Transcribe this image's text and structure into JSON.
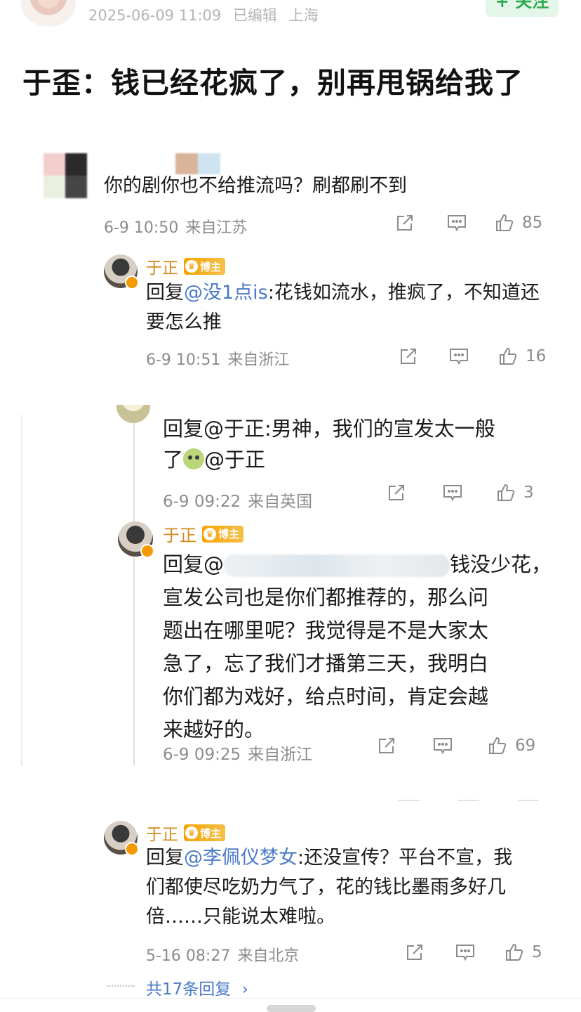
{
  "header": {
    "timestamp": "2025-06-09 11:09",
    "edited": "已编辑",
    "location": "上海",
    "follow_label": "+ 关注"
  },
  "headline": "于歪：钱已经花疯了，别再甩锅给我了",
  "comment1": {
    "text": "你的剧你也不给推流吗？刷都刷不到",
    "time": "6-9 10:50",
    "from": "来自江苏",
    "likes": "85"
  },
  "reply1": {
    "user": "于正",
    "badge": "博主",
    "prefix": "回复",
    "mention": "@没1点is",
    "text": ":花钱如流水，推疯了，不知道还要怎么推",
    "time": "6-9 10:51",
    "from": "来自浙江",
    "likes": "16"
  },
  "comment2": {
    "text_line1": "回复@于正:男神，我们的宣发太一般",
    "text_line2_pre": "了",
    "text_line2_post": "@于正",
    "time": "6-9 09:22",
    "from": "来自英国",
    "likes": "3"
  },
  "reply2": {
    "user": "于正",
    "badge": "博主",
    "prefix": "回复@",
    "line1_tail": "钱没少花，",
    "line2": "宣发公司也是你们都推荐的，那么问",
    "line3": "题出在哪里呢？我觉得是不是大家太",
    "line4": "急了，忘了我们才播第三天，我明白",
    "line5": "你们都为戏好，给点时间，肯定会越",
    "line6": "来越好的。",
    "time": "6-9 09:25",
    "from": "来自浙江",
    "likes": "69"
  },
  "reply3": {
    "user": "于正",
    "badge": "博主",
    "prefix": "回复",
    "mention": "@李佩仪梦女",
    "text1": ":还没宣传？平台不宣，我",
    "text2": "们都使尽吃奶力气了，花的钱比墨雨多好几",
    "text3": "倍……只能说太难啦。",
    "time": "5-16 08:27",
    "from": "来自北京",
    "likes": "5"
  },
  "more_replies": "共17条回复",
  "icons": [
    "share-icon",
    "comment-icon",
    "like-icon",
    "chevron-right-icon"
  ],
  "colors": {
    "link": "#4a79c8",
    "username": "#d28a1c",
    "follow": "#2fa84f",
    "meta": "#8c8c8c"
  }
}
